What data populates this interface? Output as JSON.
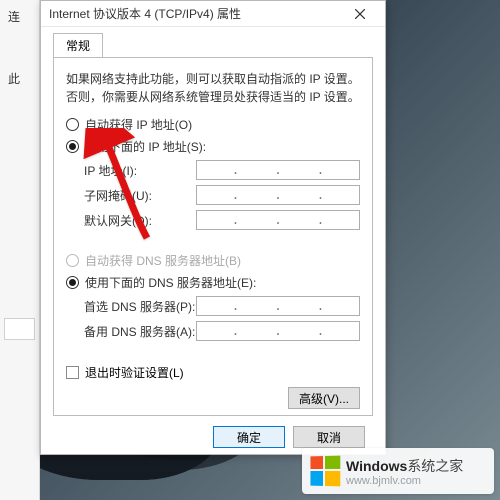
{
  "left_panel": {
    "label1": "连",
    "label2": "此"
  },
  "dialog": {
    "title": "Internet 协议版本 4 (TCP/IPv4) 属性",
    "tab": "常规",
    "info": "如果网络支持此功能，则可以获取自动指派的 IP 设置。否则，你需要从网络系统管理员处获得适当的 IP 设置。",
    "ip": {
      "auto_label": "自动获得 IP 地址(O)",
      "manual_label": "使用下面的 IP 地址(S):",
      "fields": {
        "ip": "IP 地址(I):",
        "mask": "子网掩码(U):",
        "gateway": "默认网关(D):"
      }
    },
    "dns": {
      "auto_label": "自动获得 DNS 服务器地址(B)",
      "manual_label": "使用下面的 DNS 服务器地址(E):",
      "fields": {
        "preferred": "首选 DNS 服务器(P):",
        "alternate": "备用 DNS 服务器(A):"
      }
    },
    "validate_label": "退出时验证设置(L)",
    "advanced_label": "高级(V)...",
    "ok_label": "确定",
    "cancel_label": "取消"
  },
  "watermark": {
    "brand": "Windows",
    "suffix": "系统之家",
    "url": "www.bjmlv.com"
  }
}
